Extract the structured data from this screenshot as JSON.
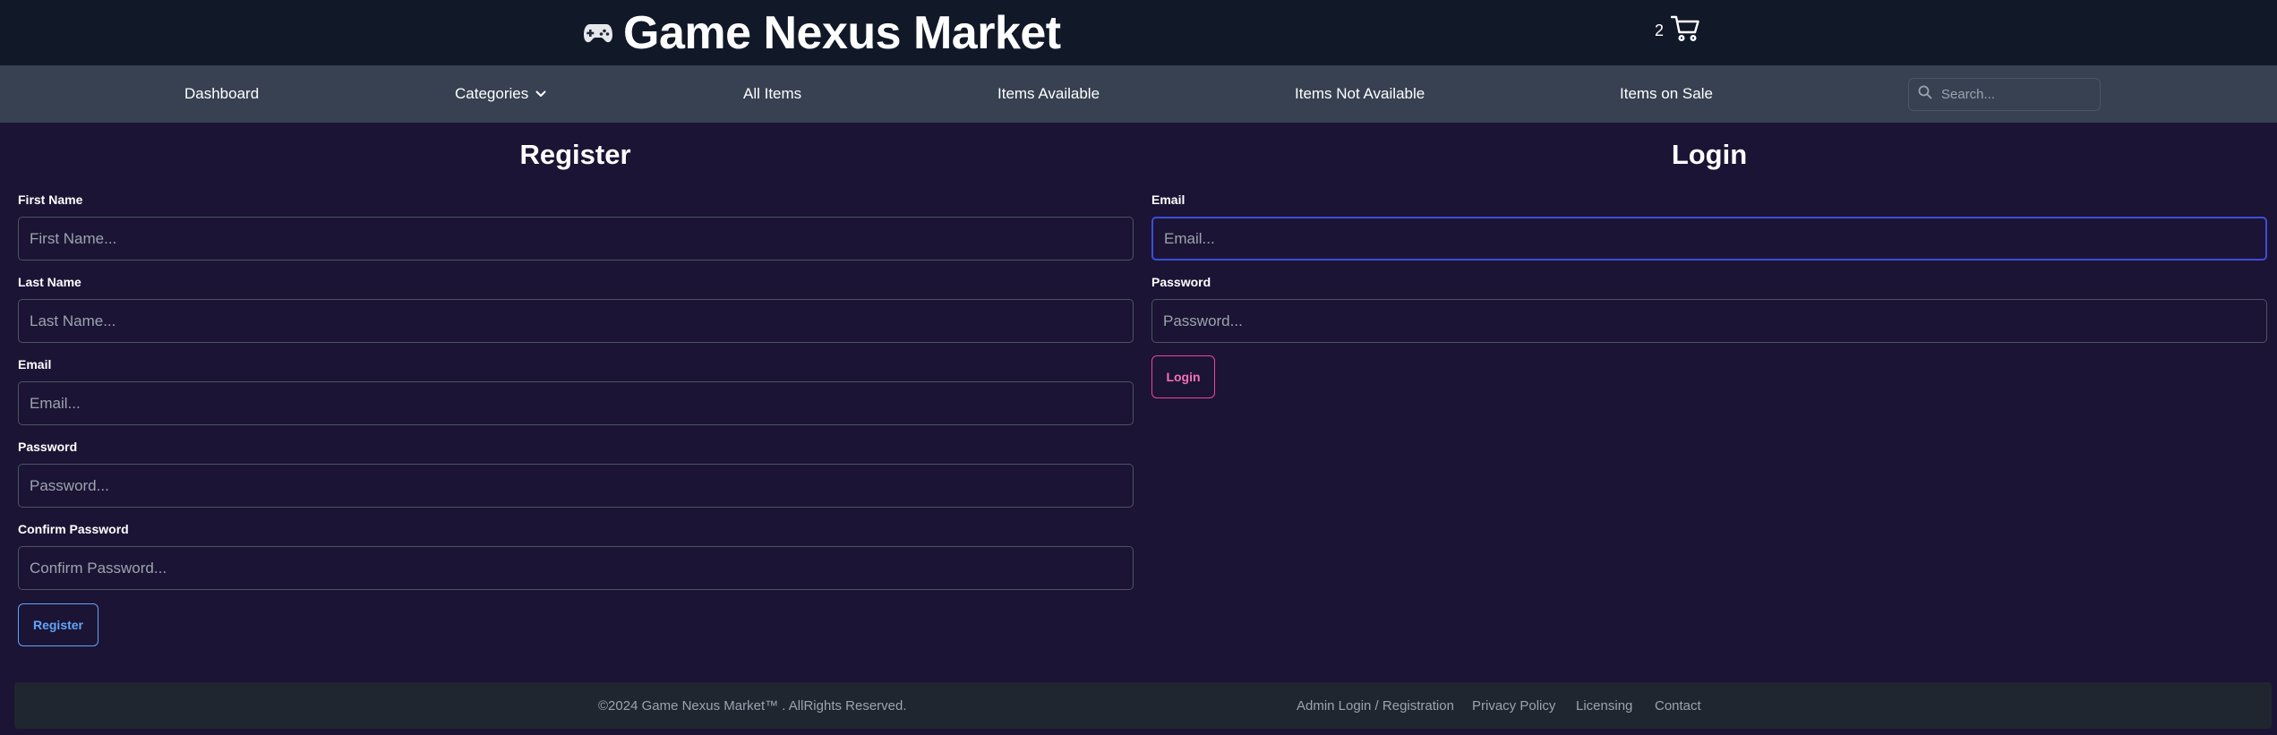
{
  "header": {
    "brand_title": "Game Nexus Market",
    "brand_icon": "gamepad-icon",
    "cart_count": "2",
    "cart_icon": "shopping-cart-icon"
  },
  "nav": {
    "items": [
      "Dashboard",
      "Categories",
      "All Items",
      "Items Available",
      "Items Not Available",
      "Items on Sale"
    ],
    "search_placeholder": "Search..."
  },
  "register": {
    "title": "Register",
    "fields": [
      {
        "label": "First Name",
        "placeholder": "First Name..."
      },
      {
        "label": "Last Name",
        "placeholder": "Last Name..."
      },
      {
        "label": "Email",
        "placeholder": "Email..."
      },
      {
        "label": "Password",
        "placeholder": "Password..."
      },
      {
        "label": "Confirm Password",
        "placeholder": "Confirm Password..."
      }
    ],
    "button_label": "Register"
  },
  "login": {
    "title": "Login",
    "fields": [
      {
        "label": "Email",
        "placeholder": "Email..."
      },
      {
        "label": "Password",
        "placeholder": "Password..."
      }
    ],
    "button_label": "Login"
  },
  "footer": {
    "copyright": "©2024 Game Nexus Market™ . AllRights Reserved.",
    "links": [
      "Admin Login / Registration",
      "Privacy Policy",
      "Licensing",
      "Contact"
    ]
  },
  "colors": {
    "page_bg": "#1b1434",
    "topbar_bg": "#111827",
    "navbar_bg": "#374151",
    "register_accent": "#60a5fa",
    "login_accent": "#ec4899",
    "focus_border": "#3b4fd8"
  }
}
